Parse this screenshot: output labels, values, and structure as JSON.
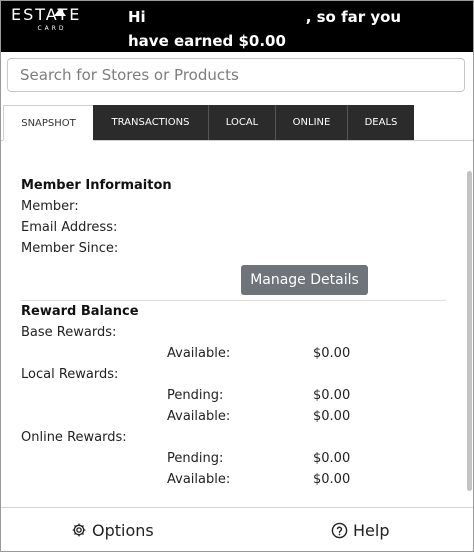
{
  "header": {
    "logo_text": "ESTATE",
    "logo_sub": "CARD",
    "greeting_line1_prefix": "Hi",
    "greeting_line1_suffix": ", so far you",
    "greeting_line2": "have earned $0.00"
  },
  "search": {
    "placeholder": "Search for Stores or Products"
  },
  "tabs": [
    {
      "label": "SNAPSHOT",
      "active": true
    },
    {
      "label": "TRANSACTIONS",
      "active": false
    },
    {
      "label": "LOCAL",
      "active": false
    },
    {
      "label": "ONLINE",
      "active": false
    },
    {
      "label": "DEALS",
      "active": false
    }
  ],
  "member_info": {
    "title": "Member Informaiton",
    "member_label": "Member:",
    "email_label": "Email Address:",
    "since_label": "Member Since:",
    "manage_button": "Manage Details"
  },
  "rewards": {
    "title": "Reward Balance",
    "base": {
      "label": "Base Rewards:",
      "available_label": "Available:",
      "available_value": "$0.00"
    },
    "local": {
      "label": "Local Rewards:",
      "pending_label": "Pending:",
      "pending_value": "$0.00",
      "available_label": "Available:",
      "available_value": "$0.00"
    },
    "online": {
      "label": "Online Rewards:",
      "pending_label": "Pending:",
      "pending_value": "$0.00",
      "available_label": "Available:",
      "available_value": "$0.00"
    }
  },
  "footer": {
    "options_label": "Options",
    "help_label": "Help"
  },
  "colors": {
    "header_bg": "#000000",
    "tab_bg": "#2b2b2b",
    "button_bg": "#6e7479"
  }
}
